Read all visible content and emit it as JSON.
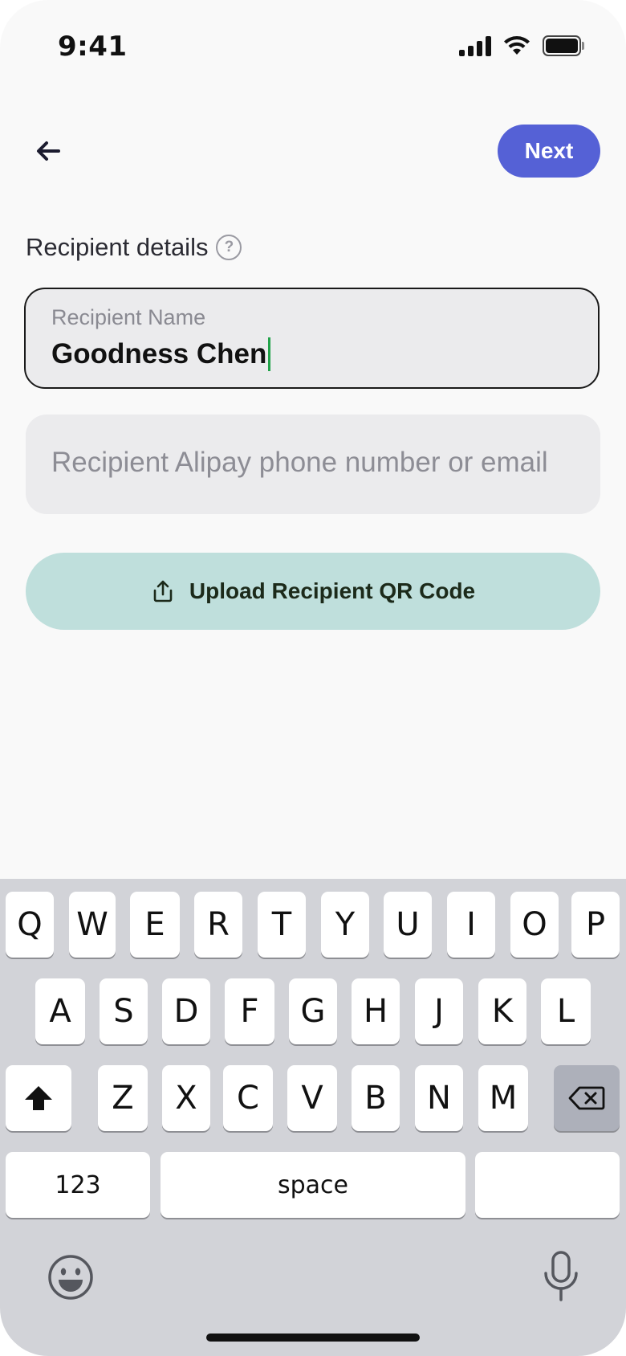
{
  "status_bar": {
    "time": "9:41"
  },
  "header": {
    "next_label": "Next"
  },
  "section": {
    "title": "Recipient details"
  },
  "recipient_name": {
    "label": "Recipient Name",
    "value": "Goodness Chen"
  },
  "alipay_field": {
    "placeholder": "Recipient Alipay phone number or email"
  },
  "upload": {
    "label": "Upload Recipient QR Code"
  },
  "keyboard": {
    "row1": [
      "Q",
      "W",
      "E",
      "R",
      "T",
      "Y",
      "U",
      "I",
      "O",
      "P"
    ],
    "row2": [
      "A",
      "S",
      "D",
      "F",
      "G",
      "H",
      "J",
      "K",
      "L"
    ],
    "row3": [
      "Z",
      "X",
      "C",
      "V",
      "B",
      "N",
      "M"
    ],
    "numbers_label": "123",
    "space_label": "space",
    "return_label": ""
  },
  "colors": {
    "accent": "#5561d6",
    "upload_bg": "#bfdfdc",
    "caret": "#22a34a"
  }
}
